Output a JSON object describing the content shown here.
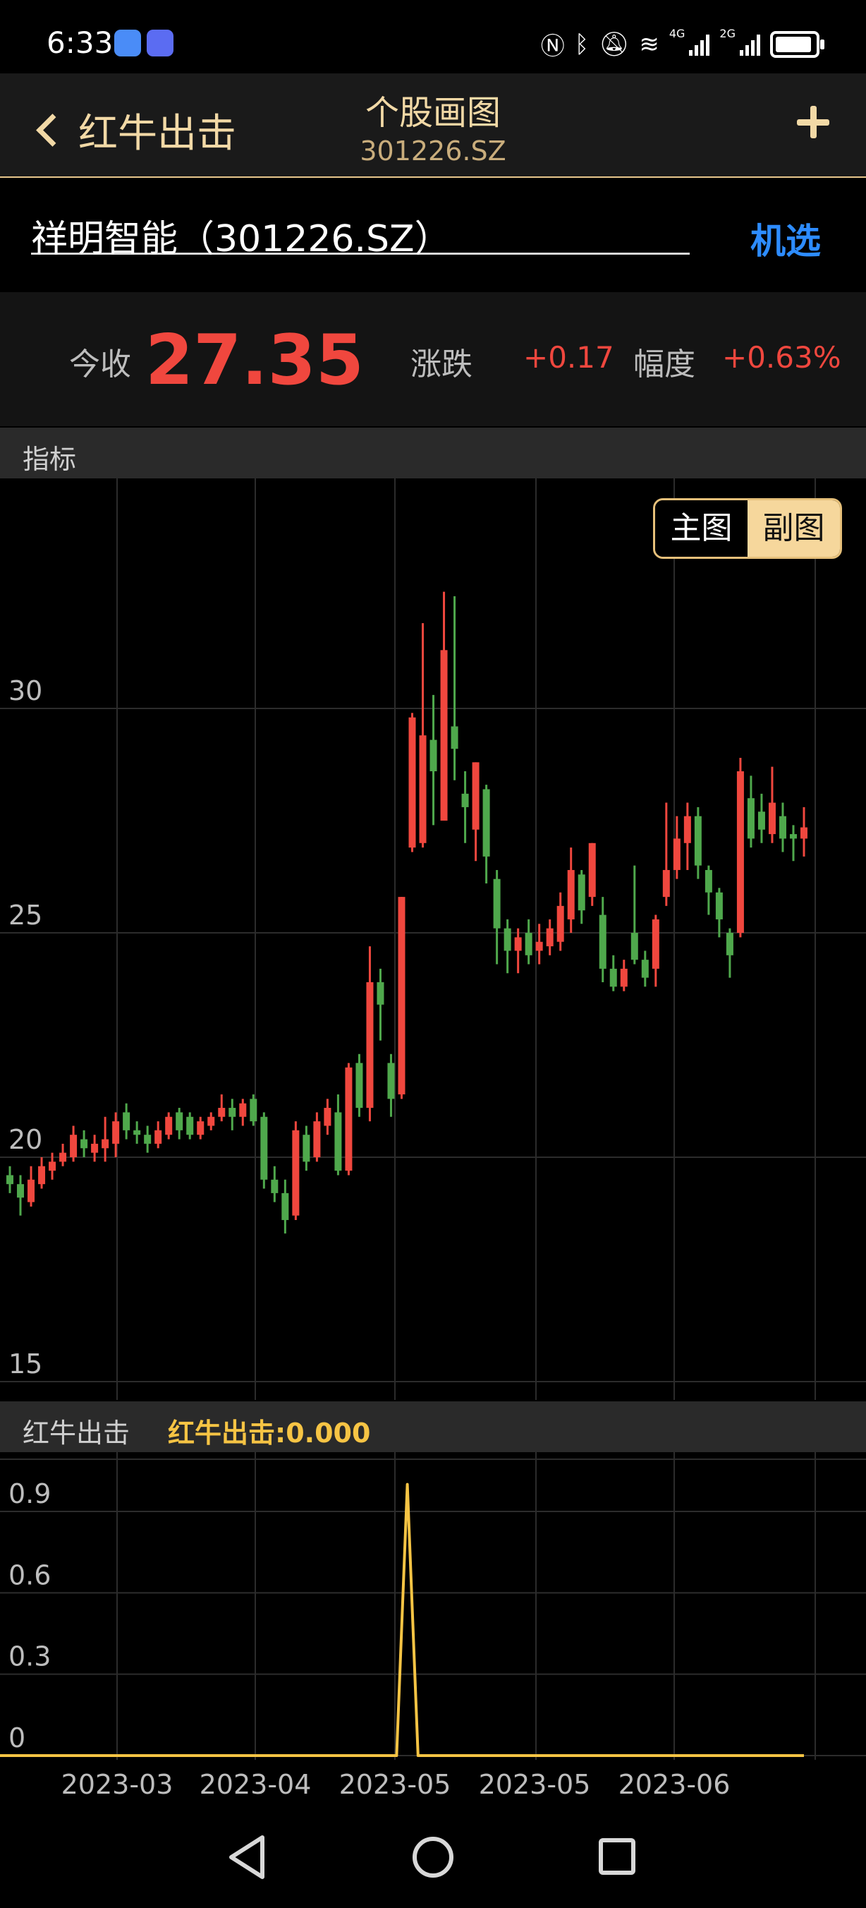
{
  "status_bar": {
    "time": "6:33",
    "battery_level": 0.92
  },
  "header": {
    "back_label": "红牛出击",
    "title": "个股画图",
    "subtitle": "301226.SZ"
  },
  "search": {
    "stock_value": "祥明智能（301226.SZ）",
    "select_label": "机选"
  },
  "quote": {
    "close_label": "今收",
    "close_value": "27.35",
    "change_label": "涨跌",
    "change_value": "+0.17",
    "pct_label": "幅度",
    "pct_value": "+0.63%"
  },
  "indicator_strip": {
    "label": "指标"
  },
  "chart_toggle": {
    "main_label": "主图",
    "sub_label": "副图",
    "selected": "副图"
  },
  "secondary_strip": {
    "label": "红牛出击",
    "formula": "红牛出击:0.000"
  },
  "colors": {
    "up": "#f0473e",
    "down": "#4fa84c",
    "indicator_line": "#f6c444",
    "accent": "#e6c07a",
    "link": "#2d8cff"
  },
  "chart_data": [
    {
      "type": "candlestick",
      "y_ticks": [
        "30",
        "25",
        "20",
        "15"
      ],
      "ylim": [
        15,
        35
      ],
      "grid": true,
      "candles": [
        {
          "o": 19.6,
          "c": 19.4,
          "h": 19.8,
          "l": 19.2
        },
        {
          "o": 19.4,
          "c": 19.1,
          "h": 19.6,
          "l": 18.7
        },
        {
          "o": 19.0,
          "c": 19.5,
          "h": 19.8,
          "l": 18.9
        },
        {
          "o": 19.4,
          "c": 19.8,
          "h": 20.0,
          "l": 19.3
        },
        {
          "o": 19.7,
          "c": 19.9,
          "h": 20.1,
          "l": 19.5
        },
        {
          "o": 19.9,
          "c": 20.1,
          "h": 20.3,
          "l": 19.8
        },
        {
          "o": 20.0,
          "c": 20.5,
          "h": 20.7,
          "l": 19.9
        },
        {
          "o": 20.4,
          "c": 20.2,
          "h": 20.6,
          "l": 20.0
        },
        {
          "o": 20.1,
          "c": 20.3,
          "h": 20.5,
          "l": 19.9
        },
        {
          "o": 20.2,
          "c": 20.4,
          "h": 20.9,
          "l": 19.9
        },
        {
          "o": 20.3,
          "c": 20.8,
          "h": 21.0,
          "l": 20.0
        },
        {
          "o": 21.0,
          "c": 20.6,
          "h": 21.2,
          "l": 20.4
        },
        {
          "o": 20.6,
          "c": 20.5,
          "h": 20.8,
          "l": 20.3
        },
        {
          "o": 20.5,
          "c": 20.3,
          "h": 20.7,
          "l": 20.1
        },
        {
          "o": 20.3,
          "c": 20.6,
          "h": 20.8,
          "l": 20.2
        },
        {
          "o": 20.5,
          "c": 20.9,
          "h": 21.0,
          "l": 20.4
        },
        {
          "o": 21.0,
          "c": 20.6,
          "h": 21.1,
          "l": 20.4
        },
        {
          "o": 20.9,
          "c": 20.5,
          "h": 21.0,
          "l": 20.4
        },
        {
          "o": 20.5,
          "c": 20.8,
          "h": 20.9,
          "l": 20.4
        },
        {
          "o": 20.7,
          "c": 20.9,
          "h": 21.0,
          "l": 20.6
        },
        {
          "o": 20.9,
          "c": 21.1,
          "h": 21.4,
          "l": 20.8
        },
        {
          "o": 21.1,
          "c": 20.9,
          "h": 21.3,
          "l": 20.6
        },
        {
          "o": 20.9,
          "c": 21.2,
          "h": 21.3,
          "l": 20.7
        },
        {
          "o": 21.3,
          "c": 20.8,
          "h": 21.4,
          "l": 20.7
        },
        {
          "o": 20.9,
          "c": 19.5,
          "h": 21.0,
          "l": 19.3
        },
        {
          "o": 19.5,
          "c": 19.2,
          "h": 19.8,
          "l": 19.0
        },
        {
          "o": 19.2,
          "c": 18.6,
          "h": 19.5,
          "l": 18.3
        },
        {
          "o": 18.7,
          "c": 20.6,
          "h": 20.8,
          "l": 18.6
        },
        {
          "o": 20.5,
          "c": 19.9,
          "h": 20.7,
          "l": 19.7
        },
        {
          "o": 20.0,
          "c": 20.8,
          "h": 21.0,
          "l": 19.9
        },
        {
          "o": 20.7,
          "c": 21.1,
          "h": 21.3,
          "l": 20.5
        },
        {
          "o": 21.0,
          "c": 19.7,
          "h": 21.4,
          "l": 19.6
        },
        {
          "o": 19.7,
          "c": 22.0,
          "h": 22.1,
          "l": 19.6
        },
        {
          "o": 22.1,
          "c": 21.1,
          "h": 22.3,
          "l": 20.9
        },
        {
          "o": 21.1,
          "c": 23.9,
          "h": 24.7,
          "l": 20.8
        },
        {
          "o": 23.9,
          "c": 23.4,
          "h": 24.2,
          "l": 22.6
        },
        {
          "o": 22.1,
          "c": 21.3,
          "h": 22.3,
          "l": 20.9
        },
        {
          "o": 21.4,
          "c": 25.8,
          "h": 25.8,
          "l": 21.3
        },
        {
          "o": 26.9,
          "c": 29.8,
          "h": 29.9,
          "l": 26.8
        },
        {
          "o": 27.0,
          "c": 29.4,
          "h": 31.9,
          "l": 26.9
        },
        {
          "o": 29.3,
          "c": 28.6,
          "h": 30.3,
          "l": 27.4
        },
        {
          "o": 27.5,
          "c": 31.3,
          "h": 32.6,
          "l": 27.5
        },
        {
          "o": 29.6,
          "c": 29.1,
          "h": 32.5,
          "l": 28.4
        },
        {
          "o": 28.1,
          "c": 27.8,
          "h": 28.6,
          "l": 27.0
        },
        {
          "o": 27.3,
          "c": 28.8,
          "h": 28.8,
          "l": 26.6
        },
        {
          "o": 28.2,
          "c": 26.7,
          "h": 28.3,
          "l": 26.1
        },
        {
          "o": 26.2,
          "c": 25.1,
          "h": 26.4,
          "l": 24.3
        },
        {
          "o": 25.1,
          "c": 24.6,
          "h": 25.3,
          "l": 24.1
        },
        {
          "o": 24.6,
          "c": 24.9,
          "h": 25.1,
          "l": 24.1
        },
        {
          "o": 25.0,
          "c": 24.5,
          "h": 25.3,
          "l": 24.3
        },
        {
          "o": 24.6,
          "c": 24.8,
          "h": 25.2,
          "l": 24.3
        },
        {
          "o": 24.7,
          "c": 25.1,
          "h": 25.3,
          "l": 24.5
        },
        {
          "o": 24.8,
          "c": 25.6,
          "h": 25.9,
          "l": 24.6
        },
        {
          "o": 25.3,
          "c": 26.4,
          "h": 26.9,
          "l": 25.0
        },
        {
          "o": 26.3,
          "c": 25.5,
          "h": 26.4,
          "l": 25.2
        },
        {
          "o": 25.8,
          "c": 27.0,
          "h": 27.0,
          "l": 25.6
        },
        {
          "o": 25.4,
          "c": 24.2,
          "h": 25.8,
          "l": 23.9
        },
        {
          "o": 24.2,
          "c": 23.8,
          "h": 24.5,
          "l": 23.7
        },
        {
          "o": 23.8,
          "c": 24.2,
          "h": 24.4,
          "l": 23.7
        },
        {
          "o": 25.0,
          "c": 24.4,
          "h": 26.5,
          "l": 24.3
        },
        {
          "o": 24.4,
          "c": 24.0,
          "h": 24.6,
          "l": 23.8
        },
        {
          "o": 24.2,
          "c": 25.3,
          "h": 25.4,
          "l": 23.8
        },
        {
          "o": 25.8,
          "c": 26.4,
          "h": 27.9,
          "l": 25.6
        },
        {
          "o": 26.4,
          "c": 27.1,
          "h": 27.6,
          "l": 26.2
        },
        {
          "o": 27.0,
          "c": 27.6,
          "h": 27.9,
          "l": 26.4
        },
        {
          "o": 27.6,
          "c": 26.5,
          "h": 27.8,
          "l": 26.2
        },
        {
          "o": 26.4,
          "c": 25.9,
          "h": 26.5,
          "l": 25.4
        },
        {
          "o": 25.9,
          "c": 25.3,
          "h": 26.0,
          "l": 24.9
        },
        {
          "o": 25.0,
          "c": 24.5,
          "h": 25.1,
          "l": 24.0
        },
        {
          "o": 25.0,
          "c": 28.6,
          "h": 28.9,
          "l": 24.9
        },
        {
          "o": 28.0,
          "c": 27.1,
          "h": 28.5,
          "l": 26.9
        },
        {
          "o": 27.7,
          "c": 27.3,
          "h": 28.1,
          "l": 27.0
        },
        {
          "o": 27.2,
          "c": 27.9,
          "h": 28.7,
          "l": 27.0
        },
        {
          "o": 27.6,
          "c": 27.1,
          "h": 27.9,
          "l": 26.8
        },
        {
          "o": 27.2,
          "c": 27.1,
          "h": 27.4,
          "l": 26.6
        },
        {
          "o": 27.1,
          "c": 27.35,
          "h": 27.8,
          "l": 26.7
        }
      ]
    },
    {
      "type": "line",
      "y_ticks": [
        "0.9",
        "0.6",
        "0.3",
        "0"
      ],
      "ylim": [
        0,
        1.05
      ],
      "grid": true,
      "x_ticks": [
        "2023-03",
        "2023-04",
        "2023-05",
        "2023-05",
        "2023-06"
      ],
      "series": [
        {
          "spike_index": 38,
          "spike_value": 1.0,
          "base_value": 0.0,
          "count": 76
        }
      ]
    }
  ]
}
